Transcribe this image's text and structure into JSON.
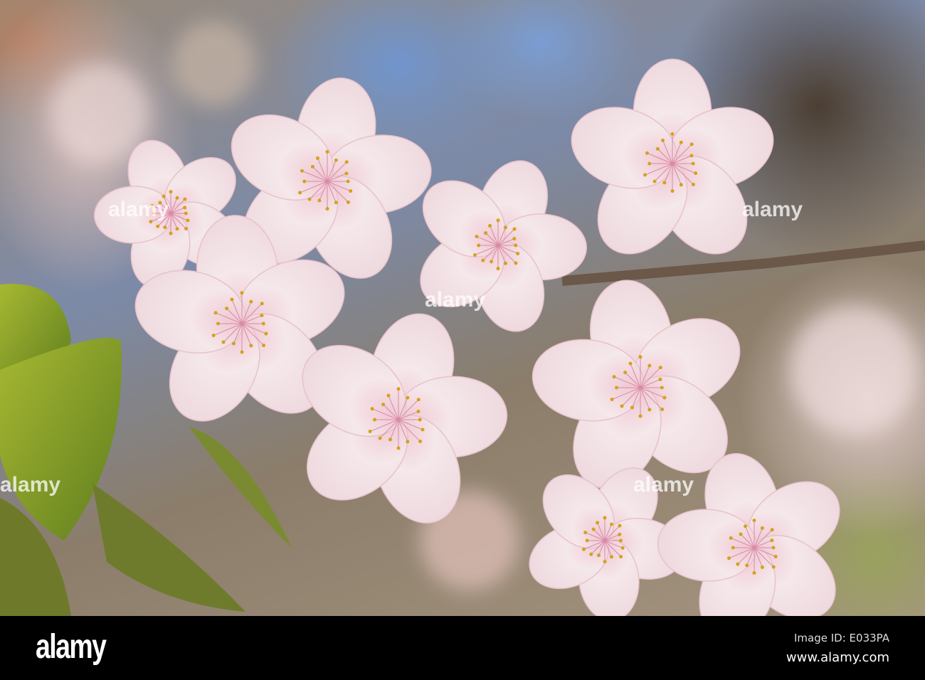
{
  "photo": {
    "subject": "cherry blossoms"
  },
  "watermark": {
    "text": "alamy",
    "mark": "a"
  },
  "footer": {
    "logo": "alamy",
    "image_id": "Image ID: E033PA",
    "url": "www.alamy.com"
  },
  "colors": {
    "petal": "#f3e4e6",
    "petal_edge": "#e8c2cb",
    "stamen": "#d4a21c",
    "leaf": "#7a9a2a",
    "footer_bg": "#000000"
  }
}
